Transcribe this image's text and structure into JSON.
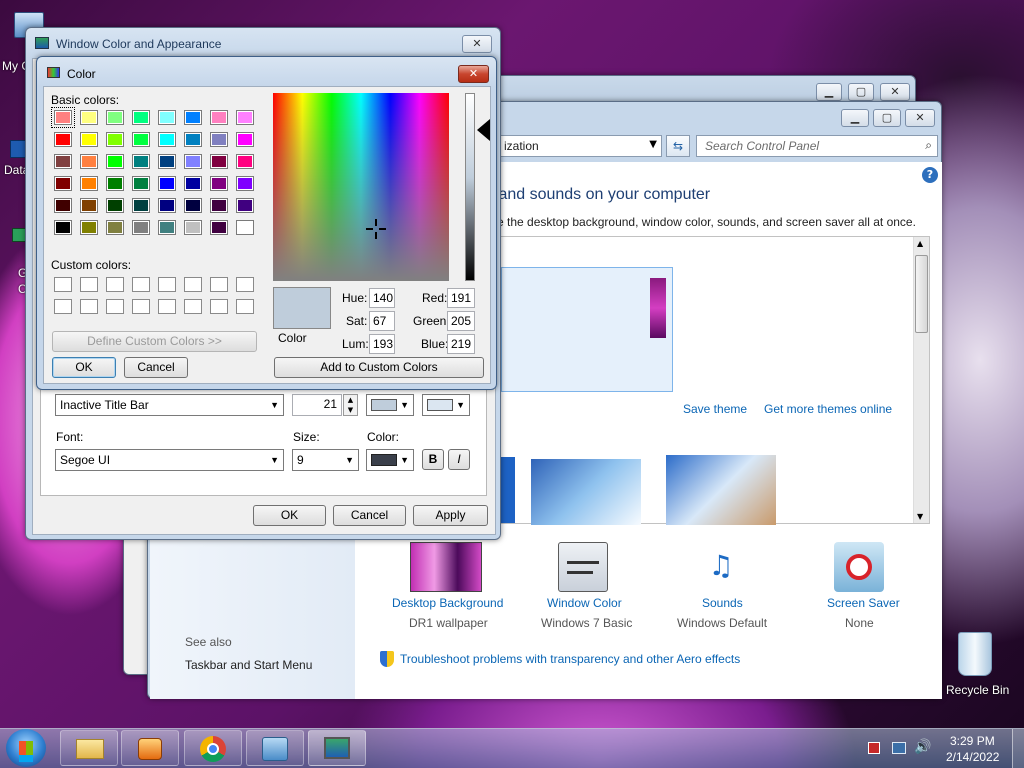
{
  "desktop": {
    "left_labels": [
      "My C",
      "Data",
      "G",
      "C"
    ],
    "recycle_bin": "Recycle Bin"
  },
  "back_window": {},
  "personalization": {
    "address_text": "ization",
    "search_placeholder": "Search Control Panel",
    "heading": "s and sounds on your computer",
    "subheading": "e the desktop background, window color, sounds, and screen saver all at once.",
    "save_theme": "Save theme",
    "get_more_themes": "Get more themes online",
    "see_also": "See also",
    "taskbar_link": "Taskbar and Start Menu",
    "items": [
      {
        "title": "Desktop Background",
        "sub": "DR1 wallpaper"
      },
      {
        "title": "Window Color",
        "sub": "Windows 7 Basic"
      },
      {
        "title": "Sounds",
        "sub": "Windows Default"
      },
      {
        "title": "Screen Saver",
        "sub": "None"
      }
    ],
    "troubleshoot": "Troubleshoot problems with transparency and other Aero effects"
  },
  "appearance": {
    "title": "Window Color and Appearance",
    "item_value": "Inactive Title Bar",
    "size_value": "21",
    "font_label": "Font:",
    "size_label": "Size:",
    "color_label": "Color:",
    "font_value": "Segoe UI",
    "font_size_value": "9",
    "bold": "B",
    "italic": "I",
    "ok": "OK",
    "cancel": "Cancel",
    "apply": "Apply"
  },
  "color_dialog": {
    "title": "Color",
    "basic_colors_label": "Basic colors:",
    "custom_colors_label": "Custom colors:",
    "define_custom": "Define Custom Colors >>",
    "ok": "OK",
    "cancel": "Cancel",
    "color_solid_label": "Color",
    "hue_label": "Hue:",
    "hue": "140",
    "sat_label": "Sat:",
    "sat": "67",
    "lum_label": "Lum:",
    "lum": "193",
    "red_label": "Red:",
    "red": "191",
    "green_label": "Green:",
    "green": "205",
    "blue_label": "Blue:",
    "blue": "219",
    "add_custom": "Add to Custom Colors",
    "selected_color": "#bfcddb",
    "basic_colors": [
      [
        "#ff8080",
        "#ffff80",
        "#80ff80",
        "#00ff80",
        "#80ffff",
        "#0080ff",
        "#ff80c0",
        "#ff80ff"
      ],
      [
        "#ff0000",
        "#ffff00",
        "#80ff00",
        "#00ff40",
        "#00ffff",
        "#0080c0",
        "#8080c0",
        "#ff00ff"
      ],
      [
        "#804040",
        "#ff8040",
        "#00ff00",
        "#008080",
        "#004080",
        "#8080ff",
        "#800040",
        "#ff0080"
      ],
      [
        "#800000",
        "#ff8000",
        "#008000",
        "#008040",
        "#0000ff",
        "#0000a0",
        "#800080",
        "#8000ff"
      ],
      [
        "#400000",
        "#804000",
        "#004000",
        "#004040",
        "#000080",
        "#000040",
        "#400040",
        "#400080"
      ],
      [
        "#000000",
        "#808000",
        "#808040",
        "#808080",
        "#408080",
        "#c0c0c0",
        "#400040",
        "#ffffff"
      ]
    ]
  },
  "taskbar": {
    "time": "3:29 PM",
    "date": "2/14/2022"
  }
}
